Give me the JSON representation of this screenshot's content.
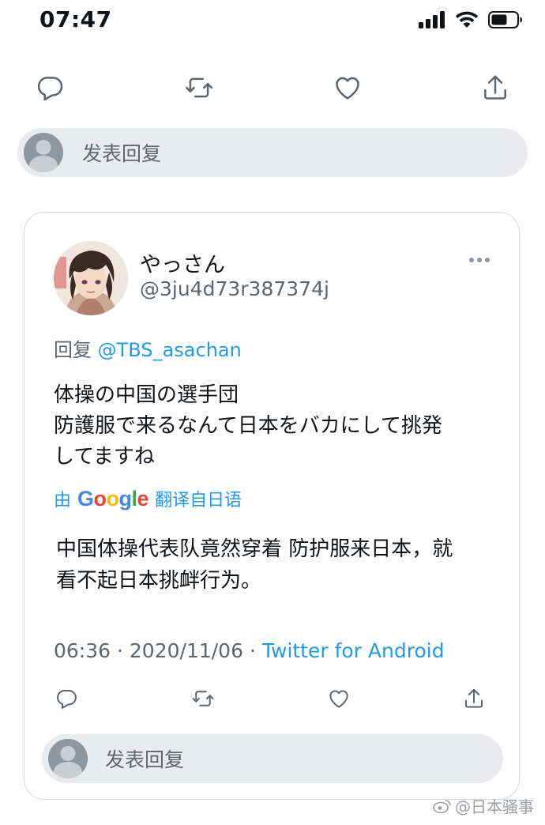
{
  "status_bar": {
    "time": "07:47"
  },
  "top_reply": {
    "placeholder": "发表回复"
  },
  "tweet": {
    "display_name": "やっさん",
    "handle": "@3ju4d73r387374j",
    "reply_prefix": "回复",
    "reply_mention": "@TBS_asachan",
    "text_lines": [
      "体操の中国の選手団",
      "防護服で来るなんて日本をバカにして挑発",
      "してますね"
    ],
    "translate": {
      "prefix": "由",
      "brand": "Google",
      "suffix": "翻译自日语"
    },
    "translated_lines": [
      "中国体操代表队竟然穿着 防护服来日本，就",
      "看不起日本挑衅行为。"
    ],
    "time": "06:36",
    "separator": "·",
    "date": "2020/11/06",
    "source": "Twitter for Android",
    "reply_placeholder": "发表回复"
  },
  "watermark": "@日本骚事"
}
